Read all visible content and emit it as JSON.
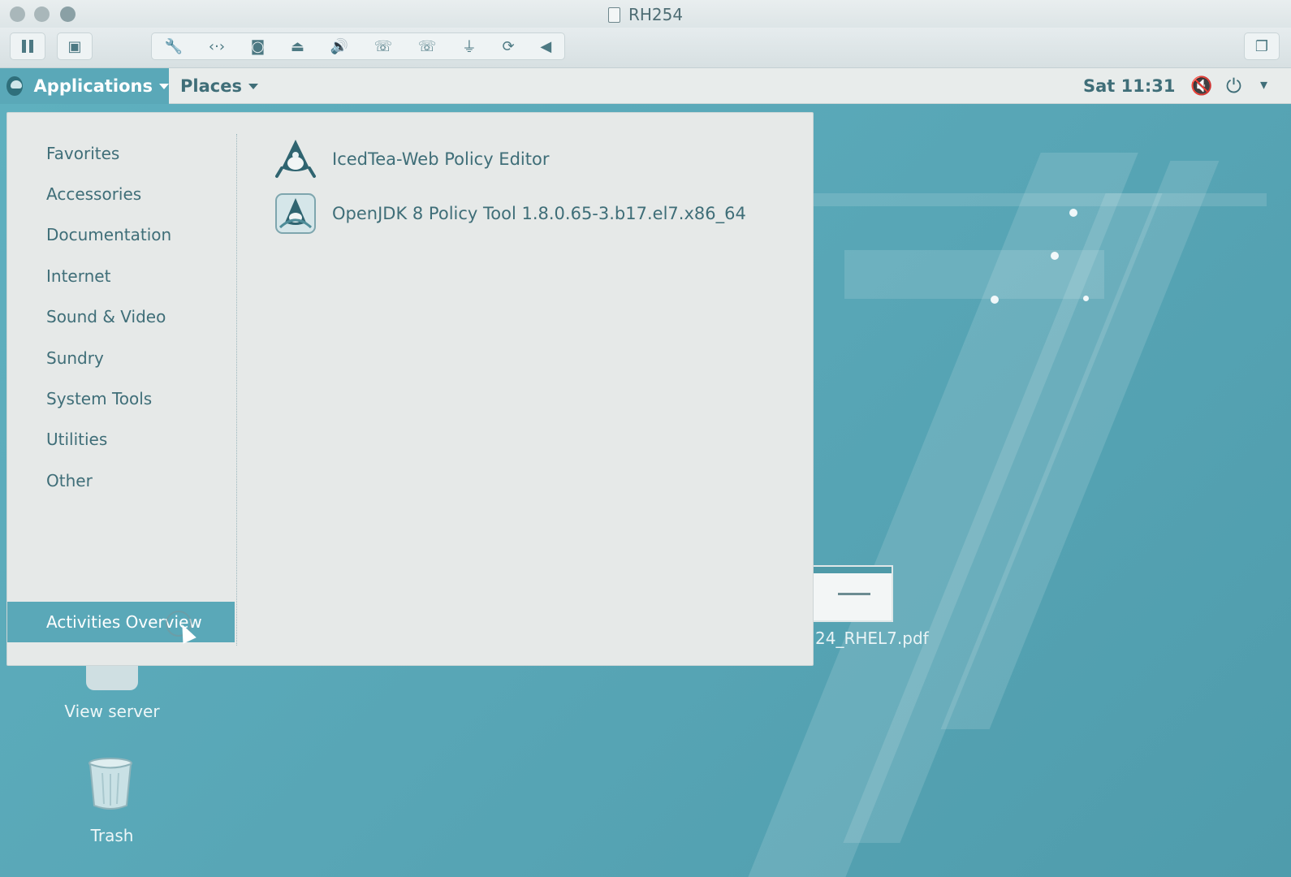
{
  "window": {
    "title": "RH254"
  },
  "vm_toolbar": {
    "tools": [
      "wrench-icon",
      "network-icon",
      "disk-icon",
      "drive-icon",
      "speaker-icon",
      "phone-icon",
      "phone-icon",
      "usb-icon",
      "refresh-icon",
      "collapse-left-icon"
    ]
  },
  "topbar": {
    "applications_label": "Applications",
    "places_label": "Places",
    "clock": "Sat 11:31"
  },
  "menu": {
    "categories": [
      "Favorites",
      "Accessories",
      "Documentation",
      "Internet",
      "Sound & Video",
      "Sundry",
      "System Tools",
      "Utilities",
      "Other"
    ],
    "activities_overview": "Activities Overview",
    "apps": [
      {
        "name": "IcedTea-Web Policy Editor",
        "icon": "java-duke-icon"
      },
      {
        "name": "OpenJDK 8 Policy Tool 1.8.0.65-3.b17.el7.x86_64",
        "icon": "policy-tool-icon"
      }
    ]
  },
  "desktop": {
    "pdf_label": "24_RHEL7.pdf",
    "view_server_label": "View server",
    "trash_label": "Trash"
  },
  "colors": {
    "accent": "#5aa8b8",
    "menu_bg": "#e6e9e8",
    "text": "#3f6e78"
  }
}
